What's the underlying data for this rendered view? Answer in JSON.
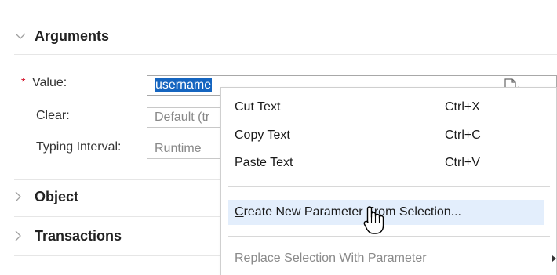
{
  "sections": {
    "arguments": "Arguments",
    "object": "Object",
    "transactions": "Transactions"
  },
  "fields": {
    "value_label": "Value:",
    "value_text": "username",
    "clear_label": "Clear:",
    "clear_text": "Default (tr",
    "typing_label": "Typing Interval:",
    "typing_text": "Runtime",
    "required_mark": "*"
  },
  "context_menu": {
    "cut": "Cut Text",
    "cut_shortcut": "Ctrl+X",
    "copy": "Copy Text",
    "copy_shortcut": "Ctrl+C",
    "paste": "Paste Text",
    "paste_shortcut": "Ctrl+V",
    "create_param_accel": "C",
    "create_param_rest": "reate New Parameter From Selection...",
    "replace_param": "Replace Selection With Parameter"
  },
  "icons": [
    "chevron-down-icon",
    "chevron-right-icon",
    "parameter-icon",
    "submenu-arrow-icon",
    "hand-pointer-icon"
  ],
  "colors": {
    "selection": "#1565c0",
    "hover": "#e3eefc",
    "required": "#d0021b"
  }
}
